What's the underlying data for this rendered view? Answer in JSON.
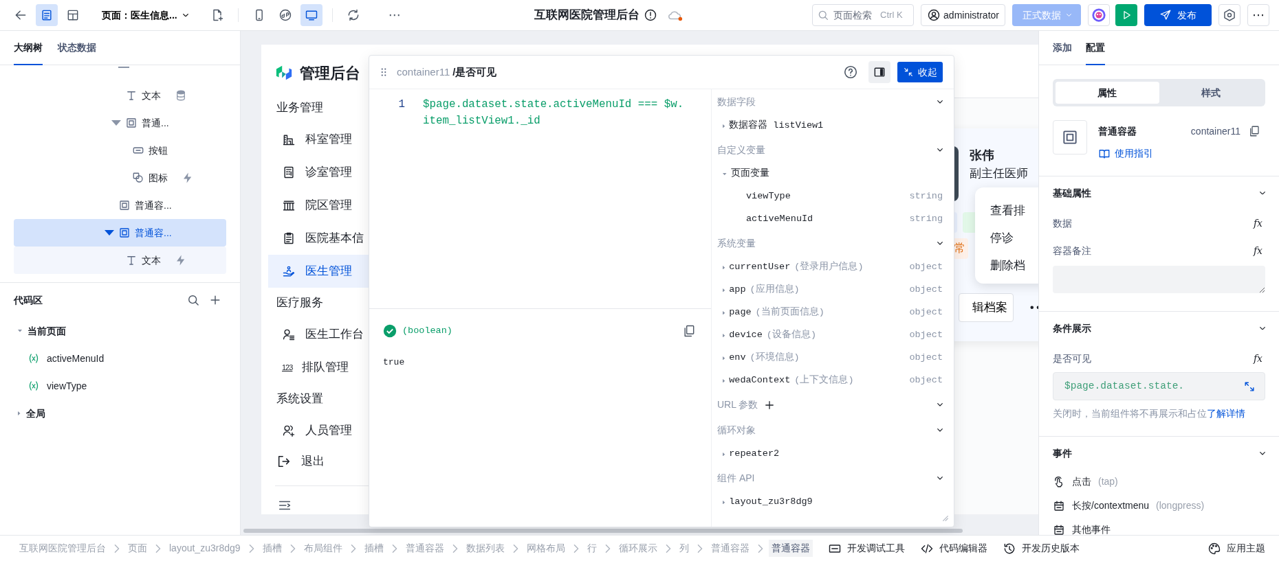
{
  "topbar": {
    "view_modes": [
      {
        "selected": true
      },
      {
        "selected": false
      }
    ],
    "page_selector": "页面：医生信息...",
    "devices": [
      {
        "kind": "phone",
        "selected": false
      },
      {
        "kind": "mini",
        "selected": false
      },
      {
        "kind": "desktop",
        "selected": true
      }
    ],
    "more": "⋯",
    "title": "互联网医院管理后台",
    "search": {
      "placeholder": "页面检索",
      "shortcut": "Ctrl K"
    },
    "user": "administrator",
    "env": {
      "label": "正式数据",
      "disabled": true
    },
    "publish": "发布",
    "menu_more": "⋯"
  },
  "left": {
    "tabs": [
      {
        "label": "大纲树",
        "selected": true
      },
      {
        "label": "状态数据",
        "selected": false
      }
    ],
    "outline": [
      {
        "kind": "clipped",
        "selected": false,
        "expanded": true,
        "children": [
          {
            "kind": "text",
            "label": "文本",
            "data_bound": true,
            "has_events": false,
            "selected": false
          },
          {
            "kind": "container",
            "label": "普通...",
            "data_bound": false,
            "has_events": false,
            "selected": false,
            "expanded": true,
            "children": [
              {
                "kind": "button",
                "label": "按钮",
                "data_bound": false,
                "has_events": false,
                "selected": false
              },
              {
                "kind": "icon",
                "label": "图标",
                "data_bound": false,
                "has_events": true,
                "selected": false
              }
            ]
          }
        ]
      },
      {
        "kind": "container",
        "label": "普通容...",
        "data_bound": false,
        "has_events": false,
        "selected": false
      },
      {
        "kind": "container",
        "label": "普通容...",
        "data_bound": false,
        "has_events": false,
        "selected": true,
        "expanded": true,
        "children": [
          {
            "kind": "text",
            "label": "文本",
            "data_bound": false,
            "has_events": true,
            "selected": false
          }
        ]
      }
    ],
    "code_area": {
      "title": "代码区",
      "groups": [
        {
          "label": "当前页面",
          "expanded": true,
          "variables": [
            "activeMenuId",
            "viewType"
          ]
        },
        {
          "label": "全局",
          "expanded": false
        }
      ]
    }
  },
  "preview": {
    "brand": "管理后台",
    "menu": [
      {
        "kind": "group",
        "label": "业务管理"
      },
      {
        "kind": "item",
        "label": "科室管理",
        "selected": false
      },
      {
        "kind": "item",
        "label": "诊室管理",
        "selected": false
      },
      {
        "kind": "item",
        "label": "院区管理",
        "selected": false
      },
      {
        "kind": "item",
        "label": "医院基本信",
        "selected": false
      },
      {
        "kind": "item",
        "label": "医生管理",
        "selected": true
      },
      {
        "kind": "group",
        "label": "医疗服务"
      },
      {
        "kind": "item",
        "label": "医生工作台",
        "selected": false
      },
      {
        "kind": "item",
        "icon_text": "123",
        "label": "排队管理",
        "selected": false
      },
      {
        "kind": "group",
        "label": "系统设置"
      },
      {
        "kind": "item",
        "label": "人员管理",
        "selected": false
      },
      {
        "kind": "exit",
        "label": "退出"
      }
    ],
    "doctor_card": {
      "name": "张伟",
      "title": "副主任医师",
      "tags": [
        {
          "color": "#e8f0fe"
        },
        {
          "color": "#e3f9e9"
        }
      ],
      "tags_2": [
        {
          "label": "常",
          "color": "#fff1e9"
        }
      ],
      "menu": [
        "查看排",
        "停诊",
        "删除档"
      ],
      "edit_button": "辑档案"
    }
  },
  "editor": {
    "path": "container11",
    "field": "/是否可见",
    "panel_toggle": {
      "selected": true
    },
    "collapse": "收起",
    "lines": [
      {
        "number": "1",
        "code": "$page.dataset.state.activeMenuId === $w.item_listView1._id"
      }
    ],
    "result": {
      "ok": true,
      "type": "(boolean)",
      "value": "true"
    },
    "sections": [
      {
        "title": "数据字段",
        "items": [
          {
            "name": "数据容器 listView1",
            "expanded": false
          }
        ]
      },
      {
        "title": "自定义变量",
        "items": [
          {
            "name": "页面变量",
            "expanded": true,
            "children": [
              {
                "name": "viewType",
                "type": "string"
              },
              {
                "name": "activeMenuId",
                "type": "string"
              }
            ]
          }
        ]
      },
      {
        "title": "系统变量",
        "items": [
          {
            "name": "currentUser",
            "note": "(登录用户信息)",
            "type": "object",
            "expanded": false
          },
          {
            "name": "app",
            "note": "(应用信息)",
            "type": "object",
            "expanded": false
          },
          {
            "name": "page",
            "note": "(当前页面信息)",
            "type": "object",
            "expanded": false
          },
          {
            "name": "device",
            "note": "(设备信息)",
            "type": "object",
            "expanded": false
          },
          {
            "name": "env",
            "note": "(环境信息)",
            "type": "object",
            "expanded": false
          },
          {
            "name": "wedaContext",
            "note": "(上下文信息)",
            "type": "object",
            "expanded": false
          }
        ]
      },
      {
        "title": "URL 参数",
        "add": true
      },
      {
        "title": "循环对象",
        "items": [
          {
            "name": "repeater2",
            "expanded": false
          }
        ]
      },
      {
        "title": "组件 API",
        "items": [
          {
            "name": "layout_zu3r8dg9",
            "expanded": false
          }
        ]
      }
    ]
  },
  "config": {
    "tabs": [
      {
        "label": "添加",
        "selected": false
      },
      {
        "label": "配置",
        "selected": true
      }
    ],
    "segments": [
      {
        "label": "属性",
        "selected": true
      },
      {
        "label": "样式",
        "selected": false
      }
    ],
    "component": {
      "name": "普通容器",
      "id": "container11",
      "guide": "使用指引"
    },
    "sections": [
      {
        "title": "基础属性",
        "fields": [
          {
            "kind": "fx",
            "label": "数据",
            "button": "fx"
          },
          {
            "kind": "fx",
            "label": "容器备注",
            "button": "fx"
          },
          {
            "kind": "textarea"
          }
        ]
      },
      {
        "title": "条件展示",
        "fields": [
          {
            "kind": "fx",
            "label": "是否可见",
            "button": "fx"
          },
          {
            "kind": "code",
            "value": "$page.dataset.state."
          },
          {
            "kind": "help",
            "text": "关闭时，当前组件将不再展示和占位",
            "link": "了解详情"
          }
        ]
      },
      {
        "title": "事件",
        "fields": [
          {
            "kind": "event",
            "label": "点击",
            "hint": "(tap)"
          },
          {
            "kind": "event",
            "label": "长按/contextmenu",
            "hint": "(longpress)"
          },
          {
            "kind": "event",
            "label": "其他事件"
          }
        ]
      }
    ]
  },
  "bottombar": {
    "breadcrumb": [
      {
        "label": "互联网医院管理后台",
        "selected": false
      },
      {
        "label": "页面",
        "selected": false
      },
      {
        "label": "layout_zu3r8dg9",
        "selected": false
      },
      {
        "label": "插槽",
        "selected": false
      },
      {
        "label": "布局组件",
        "selected": false
      },
      {
        "label": "插槽",
        "selected": false
      },
      {
        "label": "普通容器",
        "selected": false
      },
      {
        "label": "数据列表",
        "selected": false
      },
      {
        "label": "网格布局",
        "selected": false
      },
      {
        "label": "行",
        "selected": false
      },
      {
        "label": "循环展示",
        "selected": false
      },
      {
        "label": "列",
        "selected": false
      },
      {
        "label": "普通容器",
        "selected": false
      },
      {
        "label": "普通容器",
        "selected": true
      }
    ],
    "tools": [
      {
        "label": "开发调试工具"
      },
      {
        "label": "代码编辑器"
      },
      {
        "label": "开发历史版本"
      },
      {
        "label": "应用主题"
      }
    ]
  }
}
